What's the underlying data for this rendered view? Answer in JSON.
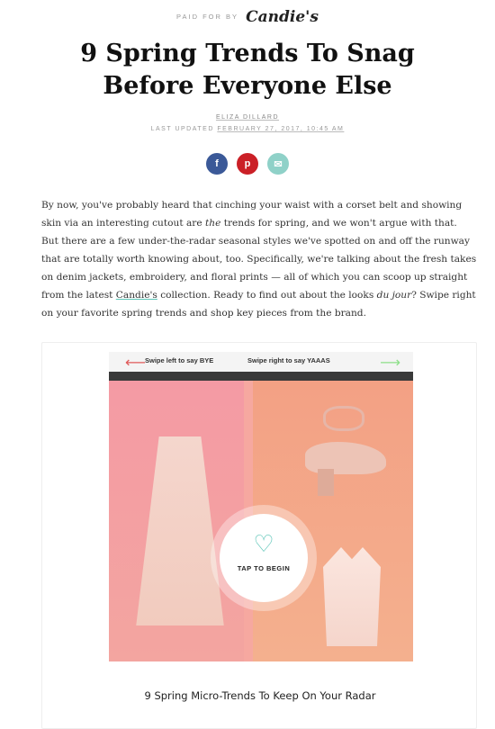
{
  "sponsor": {
    "paid_label": "PAID FOR BY",
    "brand": "Candie's"
  },
  "article": {
    "title_line1": "9 Spring Trends To Snag",
    "title_line2": "Before Everyone Else",
    "author": "ELIZA DILLARD",
    "updated_label": "LAST UPDATED",
    "updated_date": "FEBRUARY 27, 2017, 10:45 AM"
  },
  "share": {
    "facebook": "f",
    "pinterest": "p",
    "email": "✉"
  },
  "body": {
    "p1": "By now, you've probably heard that cinching your waist with a corset belt and showing skin via an interesting cutout are ",
    "em1": "the",
    "p2": " trends for spring, and we won't argue with that. But there are a few under-the-radar seasonal styles we've spotted on and off the runway that are totally worth knowing about, too. Specifically, we're talking about the fresh takes on denim jackets, embroidery, and floral prints — all of which you can scoop up straight from the latest ",
    "link": "Candie's",
    "p3": " collection. Ready to find out about the looks ",
    "em2": "du jour",
    "p4": "? Swipe right on your favorite spring trends and shop key pieces from the brand."
  },
  "widget": {
    "swipe_left": "Swipe left to say BYE",
    "swipe_right": "Swipe right to say YAAAS",
    "left_arrow": "⟵",
    "right_arrow": "⟶",
    "heart_icon": "♡",
    "tap_label": "TAP TO BEGIN",
    "caption": "9 Spring Micro-Trends To Keep On Your Radar"
  },
  "colors": {
    "facebook": "#3b5998",
    "pinterest": "#cb2027",
    "email": "#8fd1c8",
    "accent": "#5fc6b9"
  }
}
